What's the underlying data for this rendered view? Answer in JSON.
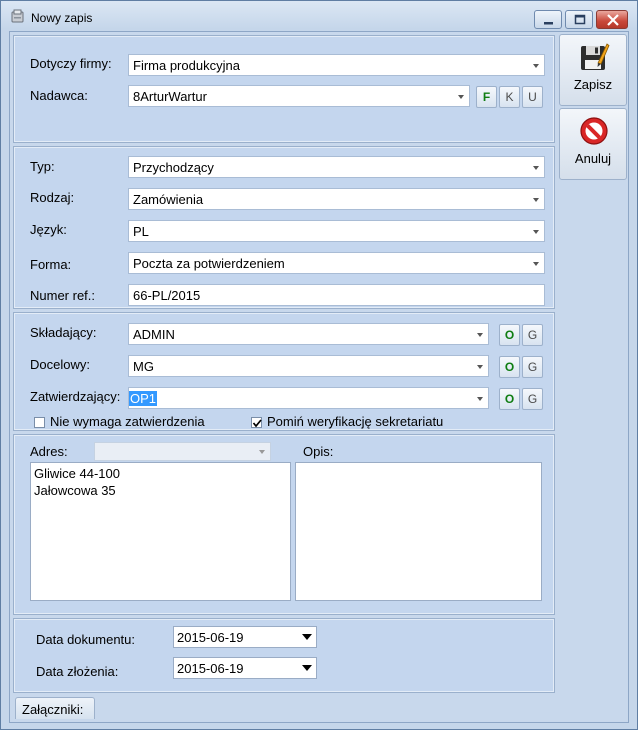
{
  "window": {
    "title": "Nowy zapis"
  },
  "company": {
    "label": "Dotyczy firmy:",
    "value": "Firma produkcyjna"
  },
  "sender": {
    "label": "Nadawca:",
    "value": "8ArturWartur",
    "buttons": [
      "F",
      "K",
      "U"
    ]
  },
  "details": {
    "type": {
      "label": "Typ:",
      "value": "Przychodzący"
    },
    "kind": {
      "label": "Rodzaj:",
      "value": "Zamówienia"
    },
    "language": {
      "label": "Język:",
      "value": "PL"
    },
    "form": {
      "label": "Forma:",
      "value": "Poczta za potwierdzeniem"
    },
    "ref": {
      "label": "Numer ref.:",
      "value": "66-PL/2015"
    }
  },
  "people": {
    "submitter": {
      "label": "Składający:",
      "value": "ADMIN"
    },
    "target": {
      "label": "Docelowy:",
      "value": "MG"
    },
    "approver": {
      "label": "Zatwierdzający:",
      "value": "OP1"
    },
    "btn_o": "O",
    "btn_g": "G",
    "no_approval": {
      "label": "Nie wymaga zatwierdzenia",
      "checked": false
    },
    "skip_secretariat": {
      "label": "Pomiń weryfikację sekretariatu",
      "checked": true
    }
  },
  "address": {
    "label": "Adres:",
    "select_value": "",
    "lines": [
      "Gliwice 44-100",
      "Jałowcowa 35"
    ]
  },
  "description": {
    "label": "Opis:",
    "value": ""
  },
  "dates": {
    "document": {
      "label": "Data dokumentu:",
      "value": "2015-06-19"
    },
    "filed": {
      "label": "Data złożenia:",
      "value": "2015-06-19"
    }
  },
  "actions": {
    "save": "Zapisz",
    "cancel": "Anuluj"
  },
  "tabs": {
    "attachments": "Załączniki:"
  }
}
